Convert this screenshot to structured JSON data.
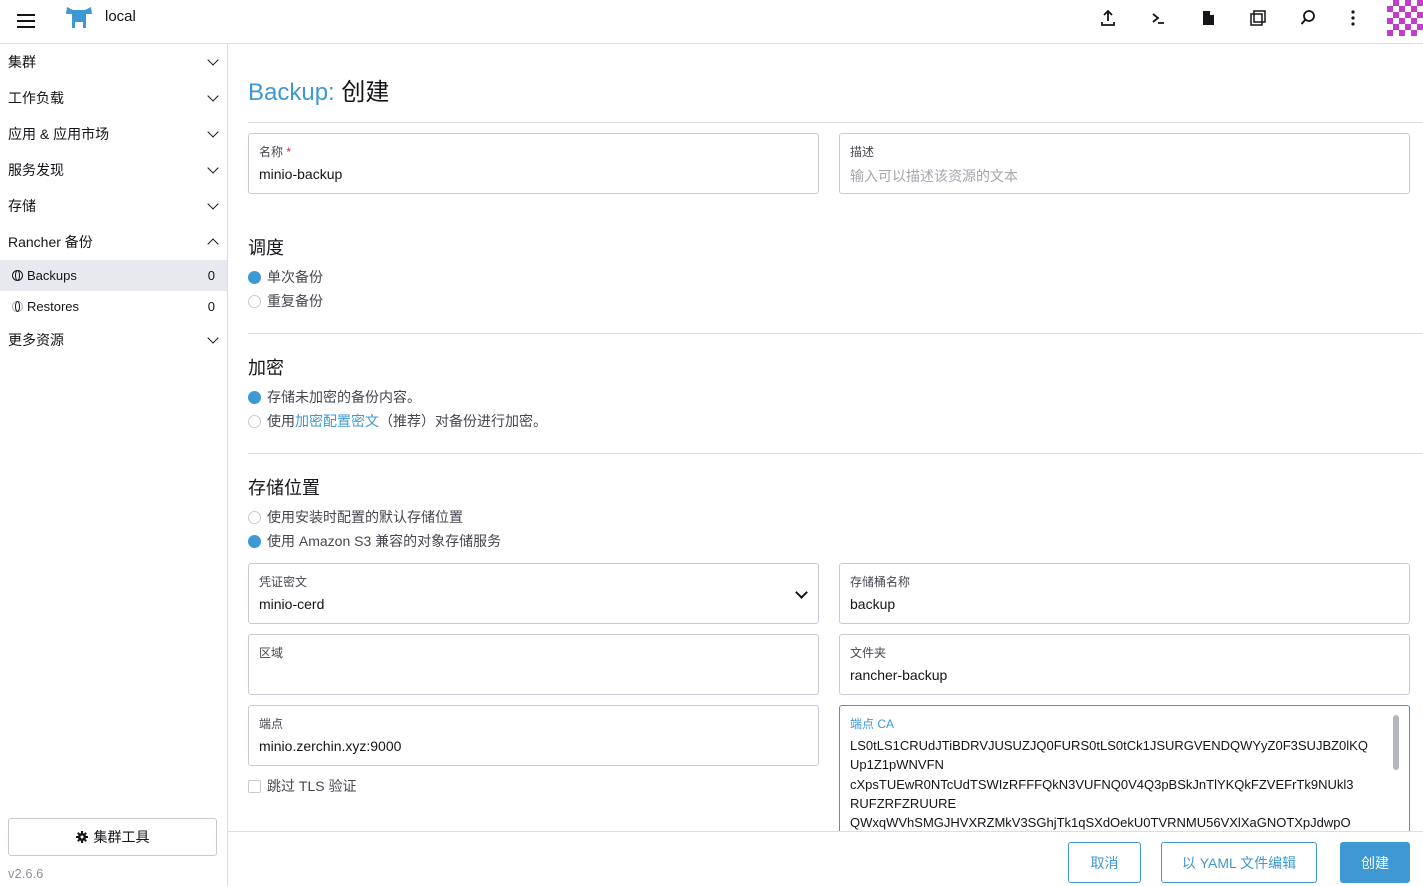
{
  "header": {
    "cluster_name": "local"
  },
  "sidebar": {
    "groups": [
      {
        "label": "集群"
      },
      {
        "label": "工作负载"
      },
      {
        "label": "应用 & 应用市场"
      },
      {
        "label": "服务发现"
      },
      {
        "label": "存储"
      },
      {
        "label": "Rancher 备份"
      }
    ],
    "items": [
      {
        "label": "Backups",
        "count": "0"
      },
      {
        "label": "Restores",
        "count": "0"
      }
    ],
    "more": "更多资源",
    "cluster_tools": "集群工具",
    "version": "v2.6.6"
  },
  "page": {
    "type_label": "Backup:",
    "action_label": "创建"
  },
  "form": {
    "name_label": "名称",
    "name_value": "minio-backup",
    "desc_label": "描述",
    "desc_placeholder": "输入可以描述该资源的文本",
    "schedule_heading": "调度",
    "schedule_options": [
      "单次备份",
      "重复备份"
    ],
    "encryption_heading": "加密",
    "encryption_option1": "存储未加密的备份内容。",
    "encryption_option2_prefix": "使用",
    "encryption_option2_link": "加密配置密文",
    "encryption_option2_suffix": "（推荐）对备份进行加密。",
    "storage_heading": "存储位置",
    "storage_options": [
      "使用安装时配置的默认存储位置",
      "使用 Amazon S3 兼容的对象存储服务"
    ],
    "credential_label": "凭证密文",
    "credential_value": "minio-cerd",
    "bucket_label": "存储桶名称",
    "bucket_value": "backup",
    "region_label": "区域",
    "region_value": "",
    "folder_label": "文件夹",
    "folder_value": "rancher-backup",
    "endpoint_label": "端点",
    "endpoint_value": "minio.zerchin.xyz:9000",
    "endpoint_ca_label": "端点 CA",
    "endpoint_ca_lines": [
      "LS0tLS1CRUdJTiBDRVJUSUZJQ0FURS0tLS0tCk1JSURGVENDQWYyZ0F3SUJBZ0lKQ",
      "Up1Z1pWNVFN",
      "cXpsTUEwR0NTcUdTSWIzRFFFQkN3VUFNQ0V4Q3pBSkJnTlYKQkFZVEFrTk9NUkl3",
      "RUFZRFZRUURE",
      "QWxqWVhSMGJHVXRZMkV3SGhjTk1qSXdOekU0TVRNMU56VXlXaGNOTXpJdwpO"
    ],
    "skip_tls_label": "跳过 TLS 验证"
  },
  "footer": {
    "cancel": "取消",
    "edit_yaml": "以 YAML 文件编辑",
    "create": "创建"
  }
}
